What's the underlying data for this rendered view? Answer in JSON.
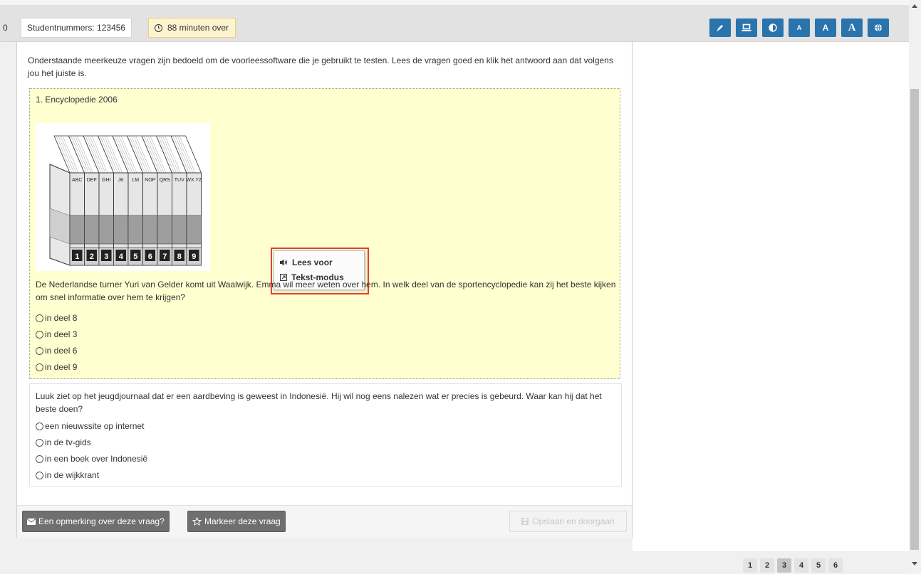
{
  "topbar": {
    "edge_number": "0",
    "student_label": "Studentnummers: 123456",
    "timer_label": "88 minuten over",
    "tools": [
      "pen-icon",
      "laptop-icon",
      "contrast-icon",
      "font-small-icon",
      "font-medium-icon",
      "font-large-icon",
      "globe-icon"
    ],
    "tool_color": "#2a74ad"
  },
  "main": {
    "intro": "Onderstaande meerkeuze vragen zijn bedoeld om de voorleessoftware die je gebruikt te testen. Lees de vragen goed en klik het antwoord aan dat volgens jou het juiste is.",
    "question1": {
      "title": "1. Encyclopedie 2006",
      "image": {
        "spine_labels": [
          "ABC",
          "DEF",
          "GHI",
          "JK",
          "LM",
          "NOP",
          "QRS",
          "TUV",
          "WX YZ"
        ],
        "volume_numbers": [
          "1",
          "2",
          "3",
          "4",
          "5",
          "6",
          "7",
          "8",
          "9"
        ]
      },
      "text": "De Nederlandse turner Yuri van Gelder komt uit Waalwijk. Emma wil meer weten over hem. In welk deel van de sportencyclopedie kan zij het beste kijken om snel informatie over hem te krijgen?",
      "options": [
        "in deel 8",
        "in deel 3",
        "in deel 6",
        "in deel 9"
      ],
      "background": "#ffffd0"
    },
    "popup": {
      "read_aloud": "Lees voor",
      "text_mode": "Tekst-modus",
      "highlight_color": "#e0403a"
    },
    "question2": {
      "text": "Luuk ziet op het jeugdjournaal dat er een aardbeving is geweest in Indonesië. Hij wil nog eens nalezen wat er precies is gebeurd. Waar kan hij dat het beste doen?",
      "options": [
        "een nieuwssite op internet",
        "in de tv-gids",
        "in een boek over Indonesië",
        "in de wijkkrant"
      ]
    }
  },
  "footer": {
    "remark_button": "Een opmerking over deze vraag?",
    "mark_button": "Markeer deze vraag",
    "save_button": "Opslaan en doorgaan"
  },
  "pagination": {
    "pages": [
      "1",
      "2",
      "3",
      "4",
      "5",
      "6"
    ],
    "current": "3"
  }
}
